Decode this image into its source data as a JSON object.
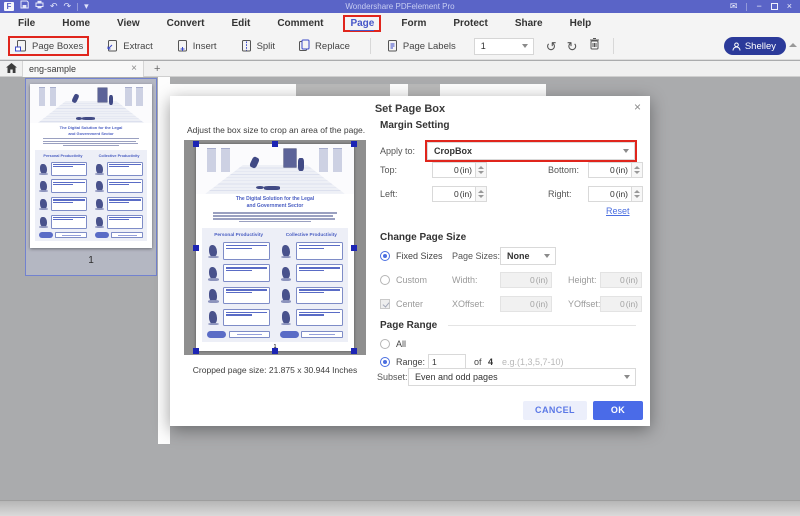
{
  "titlebar": {
    "title": "Wondershare PDFelement Pro"
  },
  "menubar": {
    "items": [
      "File",
      "Home",
      "View",
      "Convert",
      "Edit",
      "Comment",
      "Page",
      "Form",
      "Protect",
      "Share",
      "Help"
    ],
    "active": "Page"
  },
  "toolbar": {
    "buttons": [
      "Page Boxes",
      "Extract",
      "Insert",
      "Split",
      "Replace",
      "Page Labels"
    ],
    "page_number": "1",
    "user": "Shelley"
  },
  "tabbar": {
    "tab": "eng-sample"
  },
  "thumbnail_panel": {
    "page_number": "1"
  },
  "document": {
    "title_line1": "The Digital Solution for the Legal",
    "title_line2": "and Government Sector",
    "col1_heading": "Personal Productivity",
    "col2_heading": "Collective Productivity"
  },
  "dialog": {
    "title": "Set Page Box",
    "preview": {
      "instruction": "Adjust the box size to crop an area of the page.",
      "page_number": "1",
      "cropped_size": "Cropped page size: 21.875 x 30.944 Inches"
    },
    "margin_setting": {
      "heading": "Margin Setting",
      "apply_to_label": "Apply to:",
      "apply_to_value": "CropBox",
      "top_label": "Top:",
      "bottom_label": "Bottom:",
      "left_label": "Left:",
      "right_label": "Right:",
      "top_value": "0",
      "bottom_value": "0",
      "left_value": "0",
      "right_value": "0",
      "unit": "(in)",
      "reset": "Reset"
    },
    "change_page_size": {
      "heading": "Change Page Size",
      "fixed_sizes": "Fixed Sizes",
      "page_sizes_label": "Page Sizes:",
      "page_sizes_value": "None",
      "custom": "Custom",
      "width_label": "Width:",
      "height_label": "Height:",
      "width_value": "0",
      "height_value": "0",
      "center": "Center",
      "xoffset_label": "XOffset:",
      "yoffset_label": "YOffset:",
      "xoffset_value": "0",
      "yoffset_value": "0"
    },
    "page_range": {
      "heading": "Page Range",
      "all": "All",
      "range_label": "Range:",
      "range_value": "1",
      "of_label": "of",
      "total": "4",
      "hint": "e.g.(1,3,5,7-10)",
      "subset_label": "Subset:",
      "subset_value": "Even and odd pages"
    },
    "buttons": {
      "cancel": "CANCEL",
      "ok": "OK"
    }
  },
  "colors": {
    "titlebar": "#5a64c7",
    "accent": "#4a6be8",
    "highlight_red": "#e0251c",
    "workspace_gray": "#aaabad"
  }
}
